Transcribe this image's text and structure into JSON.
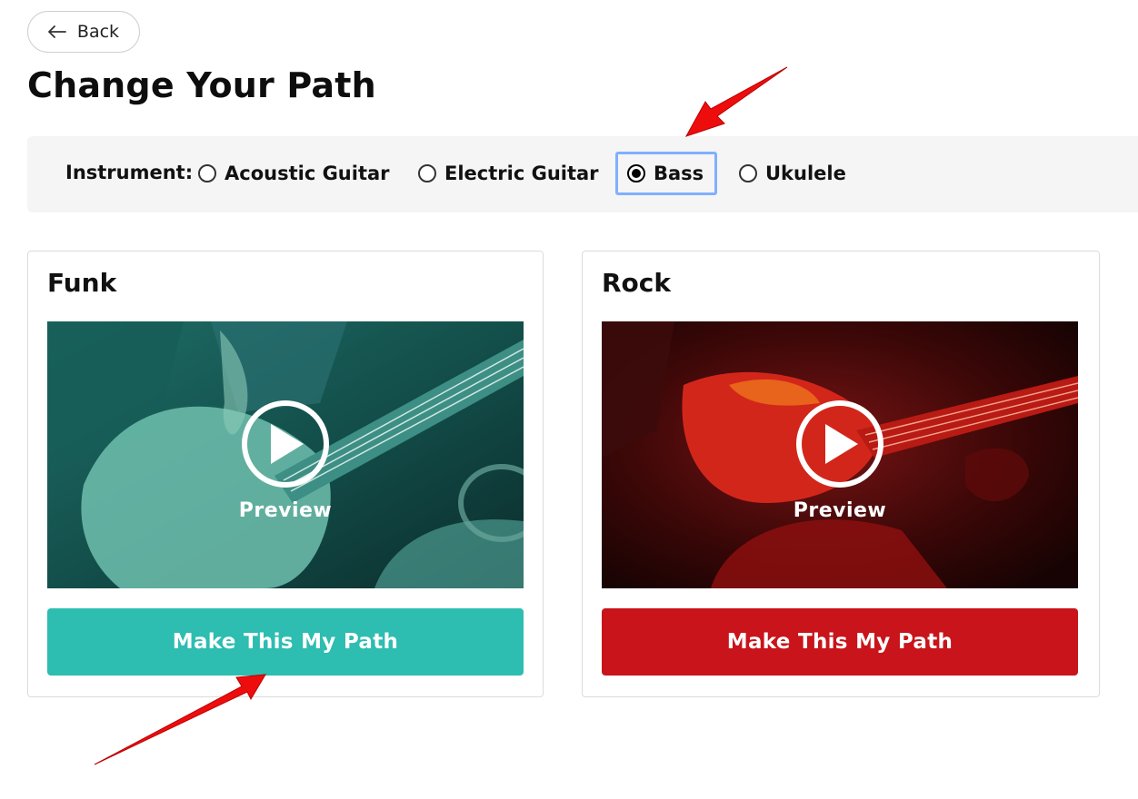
{
  "nav": {
    "back_label": "Back"
  },
  "page": {
    "title": "Change Your Path"
  },
  "instrument_picker": {
    "label": "Instrument:",
    "options": [
      {
        "label": "Acoustic Guitar",
        "selected": false
      },
      {
        "label": "Electric Guitar",
        "selected": false
      },
      {
        "label": "Bass",
        "selected": true
      },
      {
        "label": "Ukulele",
        "selected": false
      }
    ]
  },
  "paths": [
    {
      "title": "Funk",
      "preview_label": "Preview",
      "cta_label": "Make This My Path",
      "accent_color": "#2dbdb1"
    },
    {
      "title": "Rock",
      "preview_label": "Preview",
      "cta_label": "Make This My Path",
      "accent_color": "#c8141a"
    }
  ],
  "annotations": {
    "arrow_color": "#ee0d0d"
  }
}
